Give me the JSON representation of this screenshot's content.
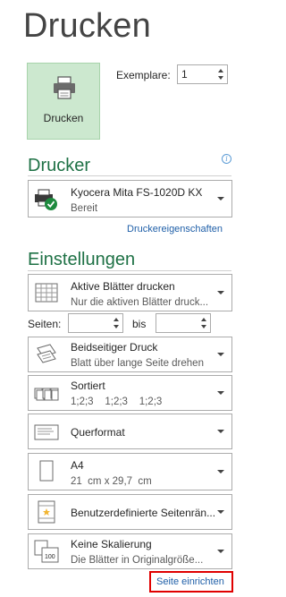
{
  "page": {
    "title": "Drucken"
  },
  "print": {
    "button_label": "Drucken",
    "copies_label": "Exemplare:",
    "copies_value": "1"
  },
  "printer": {
    "heading": "Drucker",
    "name": "Kyocera Mita FS-1020D KX",
    "status": "Bereit",
    "properties_link": "Druckereigenschaften"
  },
  "settings": {
    "heading": "Einstellungen",
    "sheets": {
      "title": "Aktive Blätter drucken",
      "subtitle": "Nur die aktiven Blätter druck..."
    },
    "pages": {
      "label": "Seiten:",
      "from": "",
      "to_label": "bis",
      "to": ""
    },
    "duplex": {
      "title": "Beidseitiger Druck",
      "subtitle": "Blatt über lange Seite drehen"
    },
    "collate": {
      "title": "Sortiert",
      "subtitle": "1;2;3    1;2;3    1;2;3"
    },
    "orientation": {
      "title": "Querformat"
    },
    "paper": {
      "title": "A4",
      "subtitle": "21  cm x 29,7  cm"
    },
    "margins": {
      "title": "Benutzerdefinierte Seitenrän..."
    },
    "scaling": {
      "title": "Keine Skalierung",
      "subtitle": "Die Blätter in Originalgröße...",
      "icon_text": "100"
    },
    "page_setup_link": "Seite einrichten"
  },
  "colors": {
    "accent_green": "#1e7145",
    "button_bg": "#cce8cf",
    "link": "#1f5fa8",
    "highlight": "#e00000"
  }
}
